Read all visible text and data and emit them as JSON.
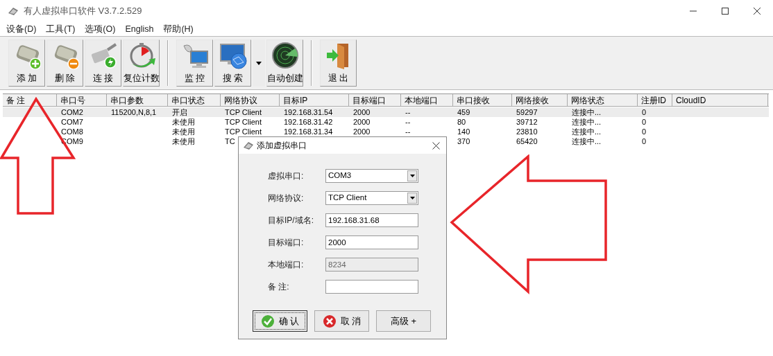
{
  "window": {
    "title": "有人虚拟串口软件 V3.7.2.529"
  },
  "menu": [
    "设备(D)",
    "工具(T)",
    "选项(O)",
    "English",
    "帮助(H)"
  ],
  "toolbar": [
    {
      "kind": "add",
      "label": "添 加"
    },
    {
      "kind": "remove",
      "label": "删 除"
    },
    {
      "kind": "connect",
      "label": "连 接"
    },
    {
      "kind": "reset",
      "label": "复位计数"
    },
    {
      "kind": "separator"
    },
    {
      "kind": "monitor",
      "label": "监 控"
    },
    {
      "kind": "search",
      "label": "搜 索"
    },
    {
      "kind": "dropdown"
    },
    {
      "kind": "radar",
      "label": "自动创建"
    },
    {
      "kind": "separator"
    },
    {
      "kind": "exit",
      "label": "退 出"
    }
  ],
  "table": {
    "columns": [
      "备 注",
      "串口号",
      "串口参数",
      "串口状态",
      "网络协议",
      "目标IP",
      "目标端口",
      "本地端口",
      "串口接收",
      "网络接收",
      "网络状态",
      "注册ID",
      "CloudID"
    ],
    "rows": [
      {
        "selected": true,
        "cells": [
          null,
          "COM2",
          "115200,N,8,1",
          "开启",
          "TCP Client",
          "192.168.31.54",
          "2000",
          "--",
          "459",
          "59297",
          "连接中...",
          "0",
          null
        ]
      },
      {
        "selected": false,
        "cells": [
          null,
          "COM7",
          null,
          "未使用",
          "TCP Client",
          "192.168.31.42",
          "2000",
          "--",
          "80",
          "39712",
          "连接中...",
          "0",
          null
        ]
      },
      {
        "selected": false,
        "cells": [
          null,
          "COM8",
          null,
          "未使用",
          "TCP Client",
          "192.168.31.34",
          "2000",
          "--",
          "140",
          "23810",
          "连接中...",
          "0",
          null
        ]
      },
      {
        "selected": false,
        "cells": [
          null,
          "COM9",
          null,
          "未使用",
          "TC",
          null,
          null,
          null,
          "370",
          "65420",
          "连接中...",
          "0",
          null
        ]
      }
    ]
  },
  "dialog": {
    "title": "添加虚拟串口",
    "fields": [
      {
        "kind": "select",
        "label": "虚拟串口:",
        "value": "COM3",
        "disabled": false
      },
      {
        "kind": "select",
        "label": "网络协议:",
        "value": "TCP Client",
        "disabled": false
      },
      {
        "kind": "text",
        "label": "目标IP/域名:",
        "value": "192.168.31.68",
        "disabled": false
      },
      {
        "kind": "text",
        "label": "目标端口:",
        "value": "2000",
        "disabled": false
      },
      {
        "kind": "text",
        "label": "本地端口:",
        "value": "8234",
        "disabled": true
      },
      {
        "kind": "text",
        "label": "备 注:",
        "disabled": false
      }
    ],
    "buttons": [
      {
        "kind": "ok",
        "label": "确 认",
        "focused": true
      },
      {
        "kind": "cancel",
        "label": "取 消",
        "focused": false
      },
      {
        "kind": "plain",
        "label": "高级 +",
        "focused": false
      }
    ]
  },
  "annotations": [
    {
      "kind": "up-arrow"
    },
    {
      "kind": "left-arrow"
    }
  ]
}
